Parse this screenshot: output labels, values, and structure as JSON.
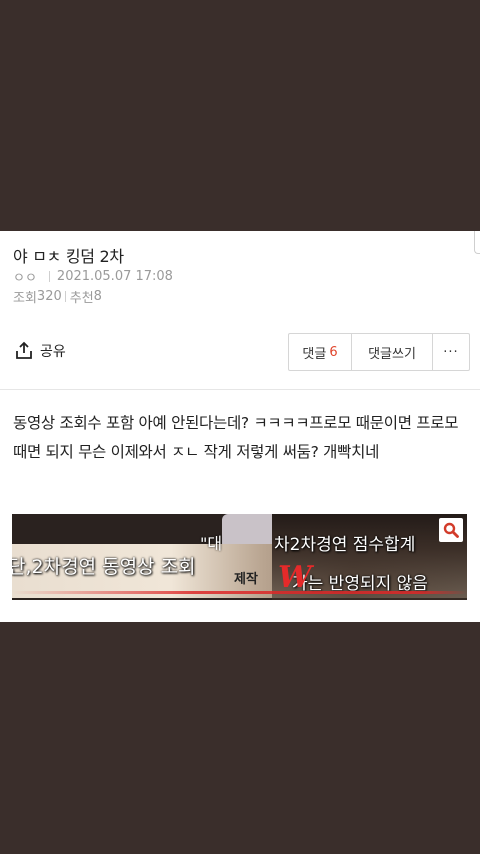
{
  "post": {
    "title": "야 ㅁㅊ 킹덤 2차",
    "author": "ㅇㅇ",
    "date": "2021.05.07 17:08",
    "views_label": "조회",
    "views": "320",
    "likes_label": "추천",
    "likes": "8"
  },
  "actions": {
    "share_label": "공유",
    "comment_label": "댓글",
    "comment_count": "6",
    "write_comment_label": "댓글쓰기",
    "more_label": "···"
  },
  "content": {
    "text": "동영상 조회수 포함 아예 안된다는데? ㅋㅋㅋㅋ프로모 때문이면 프로모 때면 되지 무슨 이제와서 ㅈㄴ 작게 저렇게 써둠? 개빡치네",
    "image": {
      "caption_top": "\"대",
      "caption_left": "단,2차경연 동영상 조회",
      "caption_right": "차2차경연 점수합계",
      "caption_right2": "가는 반영되지 않음",
      "watermark_text": "제작",
      "watermark_logo": "W"
    }
  },
  "icons": {
    "share": "share-icon",
    "search": "search-icon"
  },
  "colors": {
    "accent": "#e0452c",
    "background": "#3a2e2b"
  }
}
